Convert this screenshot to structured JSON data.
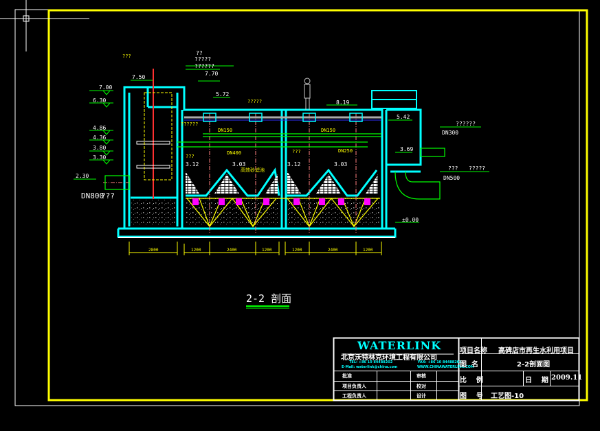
{
  "drawing": {
    "section_title": "2-2 剖面",
    "elevations": {
      "left": [
        "7.00",
        "6.30",
        "4.86",
        "4.36",
        "3.80",
        "3.30"
      ],
      "inlet": "2.30",
      "top_left": "7.50",
      "top_mid": "7.70",
      "water_mid": "5.72",
      "roof": "8.19",
      "right_water": "5.42",
      "right_mid": "3.69",
      "cone1": "3.12",
      "cone2": "3.03",
      "cone3": "3.12",
      "cone4": "3.03",
      "ground": "±0.00"
    },
    "pipe_labels": {
      "inlet_pipe": "DN800",
      "inlet_note": "??",
      "dn150_a": "DN150",
      "dn400": "DN400",
      "dn150_b": "DN150",
      "dn250": "DN250",
      "outlet_top": "DN300",
      "outlet_bottom": "DN500"
    },
    "notes": {
      "top_left": "???",
      "top_mid_1": "??",
      "top_mid_2": "?????",
      "top_mid_3": "??????",
      "roof_note": "?????",
      "left_yellow": "??????",
      "media": "高效砂滤池",
      "mid_yellow_1": "???",
      "mid_yellow_2": "???",
      "outlet_top_note": "??????",
      "outlet_bottom_note_1": "???",
      "outlet_bottom_note_2": "?????"
    },
    "dimensions": [
      "2800",
      "1200",
      "2400",
      "1200",
      "1200",
      "2400",
      "1200"
    ]
  },
  "title_block": {
    "logo": "WATERLINK",
    "company": "北京沃特林克环境工程有限公司",
    "tel": "TEL: +86 10 84488202",
    "fax": "FAX: +86 10 84488203",
    "email": "E-Mail: waterlink@china.com",
    "web": "WWW.CHINAWATERLINK.COM",
    "sign_rows": [
      {
        "label": "批准",
        "label2": "审核"
      },
      {
        "label": "项目负责人",
        "label2": "校对"
      },
      {
        "label": "工程负责人",
        "label2": "设计"
      }
    ],
    "project_label": "项目名称",
    "project_value": "高碑店市再生水利用项目",
    "name_label": "图  名",
    "name_value": "2-2剖面图",
    "scale_label": "比    例",
    "scale_value": "",
    "date_label": "日    期",
    "date_value": "2009.11",
    "number_label": "图    号",
    "number_value": "工艺图-10"
  },
  "colors": {
    "background": "#000000",
    "frame": "#ffff00",
    "structure": "#00ffff",
    "pipe": "#00ff00",
    "annotation": "#ffff00",
    "centerline": "#ff8080",
    "accent": "#ff00ff"
  }
}
